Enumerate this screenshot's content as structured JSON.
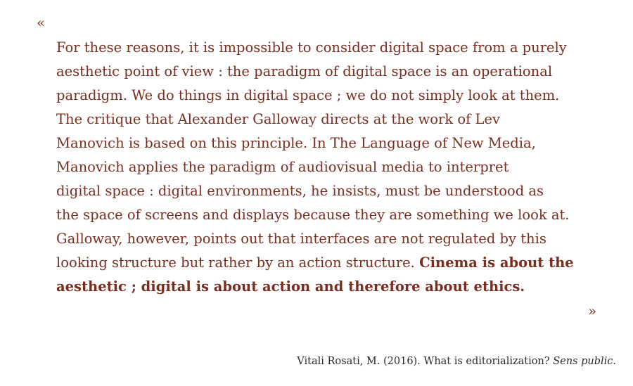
{
  "quote": {
    "open_mark": "«",
    "close_mark": "»",
    "lines": [
      "For these reasons, it is impossible to consider digital space from a purely",
      "aesthetic point of view : the paradigm of digital space is an operational",
      "paradigm. We do things in digital space ; we do not simply look at them.",
      "The critique that Alexander Galloway directs at the work of Lev",
      "Manovich is based on this principle. In The Language of New Media,",
      "Manovich applies the paradigm of audiovisual media to interpret",
      "digital space : digital environments, he insists, must be understood as",
      "the space of screens and displays because they are something we look at.",
      "Galloway, however, points out that interfaces are not regulated by this"
    ],
    "line10_regular": "looking structure but rather by an action structure. ",
    "line10_bold": "Cinema is about the",
    "line11_bold": "aesthetic ; digital is about action and therefore about ethics."
  },
  "citation": {
    "text": "Vitali Rosati, M. (2016). What is editorialization? ",
    "source": "Sens public",
    "end": "."
  },
  "colors": {
    "quote_text": "#7a2e1f",
    "citation_text": "#2a2a2a",
    "background": "#ffffff"
  }
}
